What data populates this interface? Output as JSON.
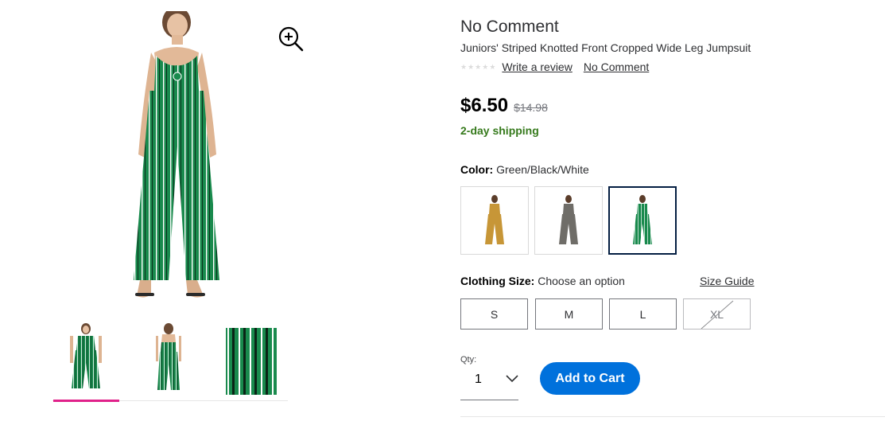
{
  "product": {
    "brand": "No Comment",
    "title": "Juniors' Striped Knotted Front Cropped Wide Leg Jumpsuit",
    "review_link": "Write a review",
    "brand_link": "No Comment",
    "rating_stars": 0,
    "price": "$6.50",
    "was_price": "$14.98",
    "shipping": "2-day shipping"
  },
  "color": {
    "label": "Color:",
    "selected": "Green/Black/White",
    "swatches": [
      {
        "name": "Mustard",
        "hex": "#c79637"
      },
      {
        "name": "Gray",
        "hex": "#6f6d68"
      },
      {
        "name": "Green/Black/White",
        "hex": "#1b8a4e"
      }
    ]
  },
  "size": {
    "label": "Clothing Size:",
    "prompt": "Choose an option",
    "guide_link": "Size Guide",
    "options": [
      {
        "label": "S",
        "available": true
      },
      {
        "label": "M",
        "available": true
      },
      {
        "label": "L",
        "available": true
      },
      {
        "label": "XL",
        "available": false
      }
    ]
  },
  "quantity": {
    "label": "Qty:",
    "value": "1"
  },
  "cart": {
    "button_label": "Add to Cart"
  },
  "icons": {
    "zoom": "zoom-in-icon",
    "qty": "chevron-down-icon"
  },
  "colors": {
    "accent": "#0071dc",
    "shipping": "#367a1c",
    "thumb_active": "#e0218a",
    "garment": "#1b8a4e"
  }
}
